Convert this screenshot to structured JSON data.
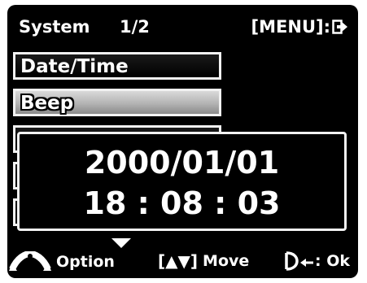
{
  "header": {
    "title": "System",
    "page": "1/2",
    "menu_label": "[MENU]:",
    "exit_icon": "exit-arrow-icon"
  },
  "menu": {
    "items": [
      {
        "label": "Date/Time",
        "selected": false
      },
      {
        "label": "Beep",
        "selected": true
      },
      {
        "label": "",
        "selected": false
      },
      {
        "label": "",
        "selected": false
      },
      {
        "label": "",
        "selected": false
      }
    ]
  },
  "popup": {
    "date": "2000/01/01",
    "time": "18 : 08 : 03"
  },
  "footer": {
    "option_label": "Option",
    "move_keys": "[▲▼]",
    "move_label": "Move",
    "ok_label": ": Ok",
    "icons": [
      "option-dial-icon",
      "shutter-return-icon"
    ]
  },
  "colors": {
    "background": "#000000",
    "text": "#ffffff",
    "border": "#f2f2f2",
    "selected_fill": "#b3b3b3"
  }
}
